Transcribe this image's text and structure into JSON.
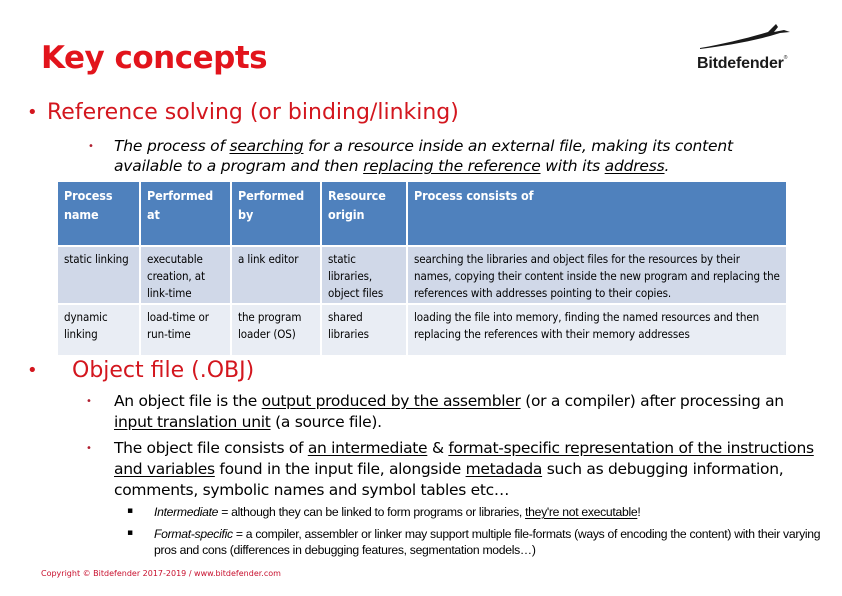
{
  "slide": {
    "title": "Key concepts",
    "logo": {
      "icon": "bitdefender-wolf-logo-icon",
      "text": "Bitdefender"
    },
    "section1": {
      "heading": "Reference solving (or binding/linking)",
      "definition": {
        "p1": "The process of ",
        "u1": "searching",
        "p2": " for a resource inside an external file, making its content available to a program and then ",
        "u2": "replacing the reference",
        "p3": " with its ",
        "u3": "address",
        "p4": "."
      },
      "table": {
        "headers": [
          "Process name",
          "Performed at",
          "Performed by",
          "Resource origin",
          "Process consists of"
        ],
        "rows": [
          [
            "static linking",
            "executable creation, at link-time",
            "a link editor",
            "static libraries, object files",
            "searching the libraries and object files for the resources by their names, copying their content inside the new program and replacing the references with addresses pointing to their copies."
          ],
          [
            "dynamic linking",
            "load-time or run-time",
            "the program loader (OS)",
            "shared libraries",
            "loading the file into memory, finding the named resources and then replacing the references with their memory addresses"
          ]
        ]
      }
    },
    "section2": {
      "heading": "Object file (.OBJ)",
      "item1": {
        "p1": "An object file is the ",
        "u1": "output produced by the assembler",
        "p2": " (or a compiler) after processing an ",
        "u2": "input translation unit",
        "p3": " (a source file)."
      },
      "item2": {
        "p1": "The object file consists of ",
        "u1": "an intermediate",
        "p2": " & ",
        "u2": "format-specific representation of the instructions and variables",
        "p3": " found in the input file, alongside ",
        "u3": "metadada",
        "p4": " such as debugging information, comments, symbolic names and symbol tables etc…"
      },
      "sub1": {
        "term": "Intermediate",
        "p1": " = although they can be linked to form programs or libraries, ",
        "u1": "they're not executable",
        "p2": "!"
      },
      "sub2": {
        "term": "Format-specific",
        "p1": " = a compiler, assembler or linker may support multiple file-formats (ways of encoding the content) with their varying pros and cons (differences in debugging features, segmentation models…)"
      }
    },
    "footer": "Copyright © Bitdefender 2017-2019  /  www.bitdefender.com",
    "colors": {
      "accent": "#e2141c",
      "table_header": "#4f81bd",
      "row_odd": "#d0d8e8",
      "row_even": "#e9edf4"
    }
  }
}
